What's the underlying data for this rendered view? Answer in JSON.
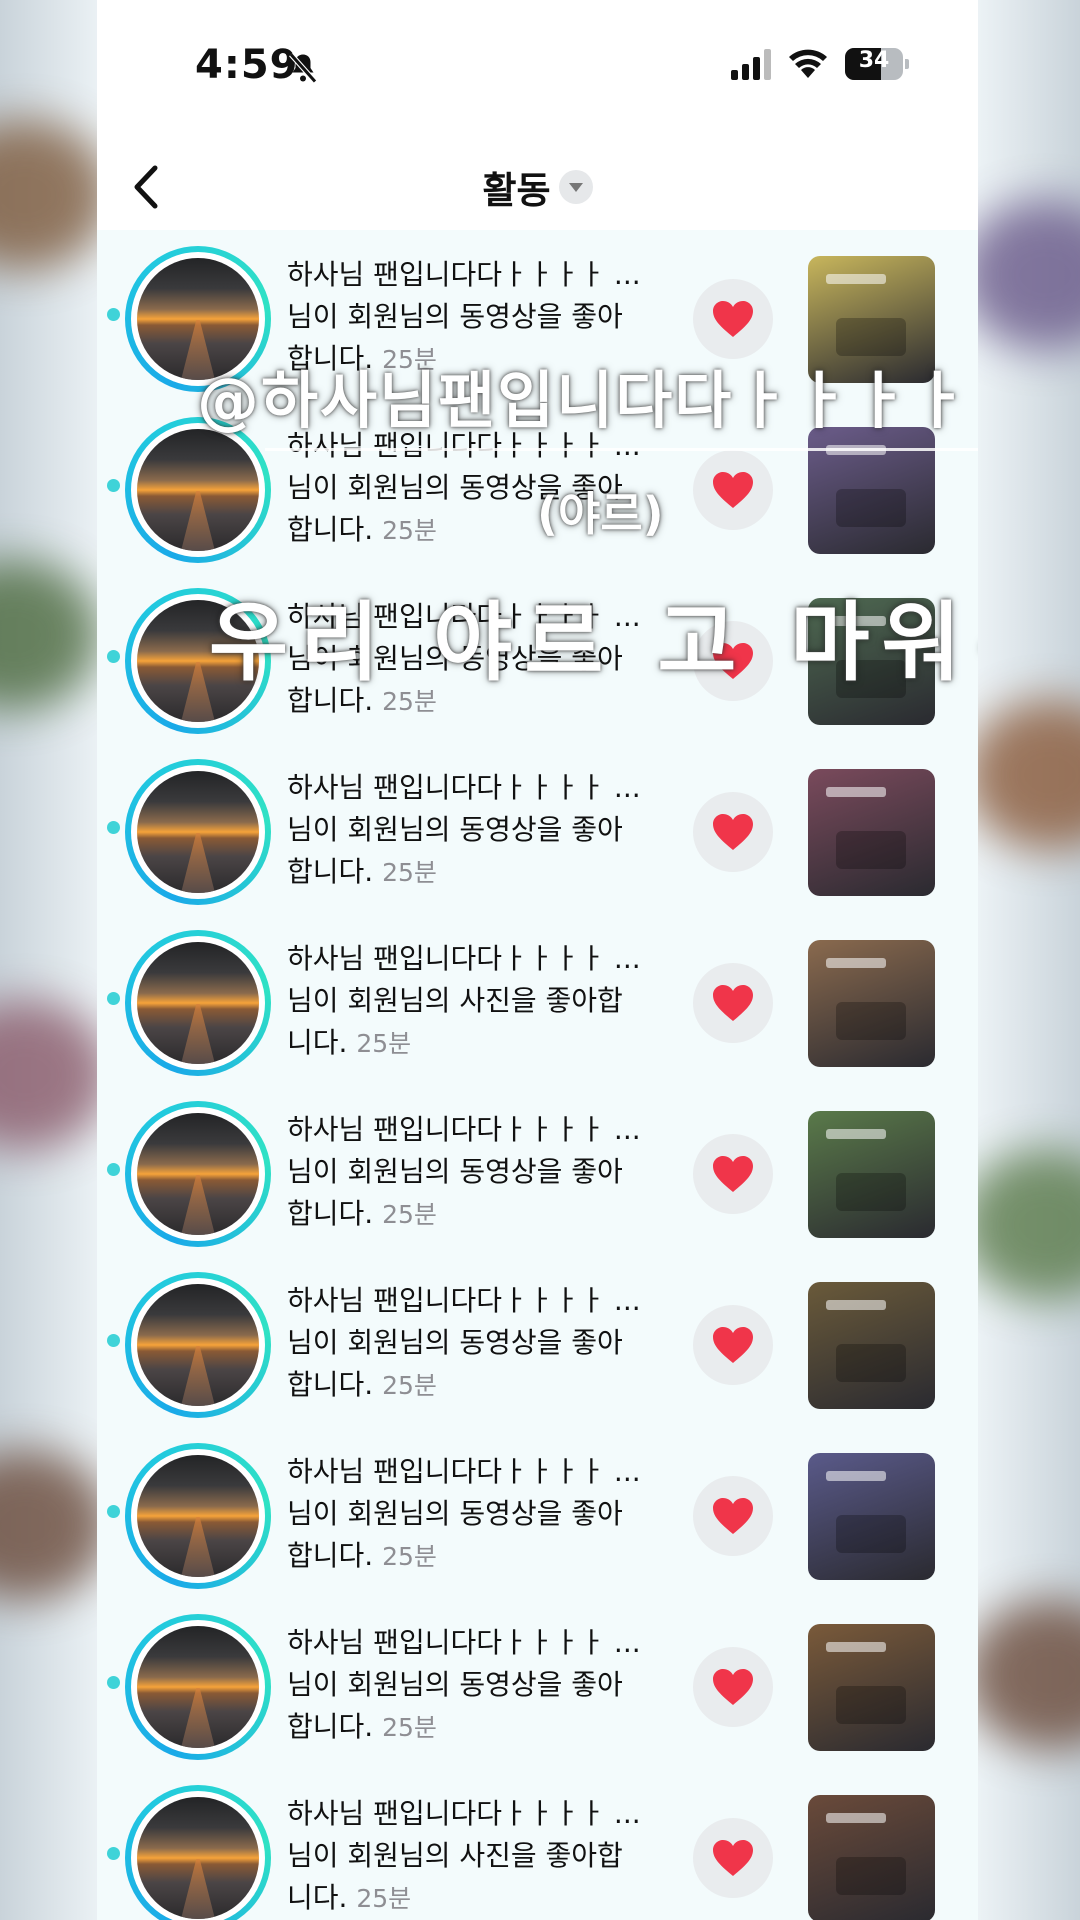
{
  "status_bar": {
    "time": "4:59",
    "battery": "34"
  },
  "header": {
    "title": "활동"
  },
  "colors": {
    "accent": "#2ac3e0",
    "heart": "#f0354a",
    "time_gray": "#8e8e93"
  },
  "activities": [
    {
      "name": "하사님 팬입니다다ㅏㅏㅏㅏ ...",
      "action": "님이 회원님의 동영상을 좋아",
      "action2": "합니다.",
      "time": "25분",
      "thumb": "#c8b65c"
    },
    {
      "name": "하사님 팬입니다다ㅏㅏㅏㅏ ...",
      "action": "님이 회원님의 동영상을 좋아",
      "action2": "합니다.",
      "time": "25분",
      "thumb": "#6b5c8a"
    },
    {
      "name": "하사님 팬입니다다ㅏㅏㅏㅏ ...",
      "action": "님이 회원님의 동영상을 좋아",
      "action2": "합니다.",
      "time": "25분",
      "thumb": "#4f6a52"
    },
    {
      "name": "하사님 팬입니다다ㅏㅏㅏㅏ ...",
      "action": "님이 회원님의 동영상을 좋아",
      "action2": "합니다.",
      "time": "25분",
      "thumb": "#7a4a5c"
    },
    {
      "name": "하사님 팬입니다다ㅏㅏㅏㅏ ...",
      "action": "님이 회원님의 사진을 좋아합",
      "action2": "니다.",
      "time": "25분",
      "thumb": "#8a6a4e"
    },
    {
      "name": "하사님 팬입니다다ㅏㅏㅏㅏ ...",
      "action": "님이 회원님의 동영상을 좋아",
      "action2": "합니다.",
      "time": "25분",
      "thumb": "#5a7a4a"
    },
    {
      "name": "하사님 팬입니다다ㅏㅏㅏㅏ ...",
      "action": "님이 회원님의 동영상을 좋아",
      "action2": "합니다.",
      "time": "25분",
      "thumb": "#6a5a3a"
    },
    {
      "name": "하사님 팬입니다다ㅏㅏㅏㅏ ...",
      "action": "님이 회원님의 동영상을 좋아",
      "action2": "합니다.",
      "time": "25분",
      "thumb": "#5a5a8a"
    },
    {
      "name": "하사님 팬입니다다ㅏㅏㅏㅏ ...",
      "action": "님이 회원님의 동영상을 좋아",
      "action2": "합니다.",
      "time": "25분",
      "thumb": "#7a5a3a"
    },
    {
      "name": "하사님 팬입니다다ㅏㅏㅏㅏ ...",
      "action": "님이 회원님의 사진을 좋아합",
      "action2": "니다.",
      "time": "25분",
      "thumb": "#6a4a3a"
    }
  ],
  "overlay": {
    "line1": "@하사님팬입니다다ㅏㅏㅏㅏ",
    "line2": "(야르)",
    "line3": "우리 야르 고 마워~"
  }
}
